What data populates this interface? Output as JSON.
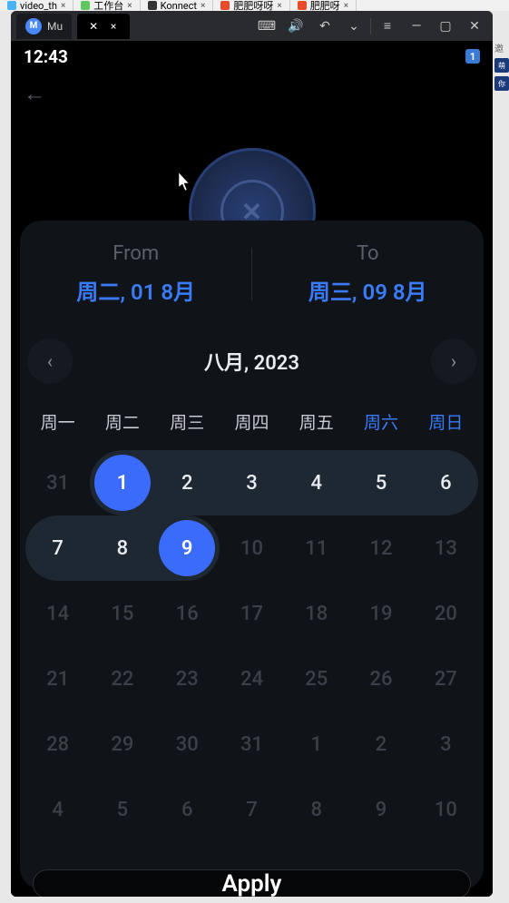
{
  "browser_tabs": [
    {
      "label": "video_th",
      "icon_color": "#4ab3f5"
    },
    {
      "label": "工作台",
      "icon_color": "#5ec85e"
    },
    {
      "label": "Konnect",
      "icon_color": "#333"
    },
    {
      "label": "肥肥呀呀",
      "icon_color": "#e84a2a"
    },
    {
      "label": "肥肥呀",
      "icon_color": "#e84a2a"
    }
  ],
  "emulator": {
    "app_initial": "M",
    "app_short": "Mu",
    "tab_icon": "✕",
    "toolbar_icons": [
      "⌨",
      "🔊",
      "↶",
      "⌄",
      "",
      "≡",
      "—",
      "▢",
      "✕"
    ]
  },
  "status": {
    "time": "12:43",
    "notif_count": "1"
  },
  "logo_text": "✕",
  "picker": {
    "from_label": "From",
    "from_value": "周二, 01 8月",
    "to_label": "To",
    "to_value": "周三, 09 8月",
    "month_title": "八月, 2023",
    "dow": [
      "周一",
      "周二",
      "周三",
      "周四",
      "周五",
      "周六",
      "周日"
    ],
    "days": [
      {
        "n": "31",
        "out": true
      },
      {
        "n": "1",
        "sel": "start"
      },
      {
        "n": "2",
        "between": true
      },
      {
        "n": "3",
        "between": true
      },
      {
        "n": "4",
        "between": true
      },
      {
        "n": "5",
        "between": true
      },
      {
        "n": "6",
        "between": true,
        "rowend": true
      },
      {
        "n": "7",
        "between": true,
        "rowstart": true
      },
      {
        "n": "8",
        "between": true
      },
      {
        "n": "9",
        "sel": "end"
      },
      {
        "n": "10",
        "out": true
      },
      {
        "n": "11",
        "out": true
      },
      {
        "n": "12",
        "out": true
      },
      {
        "n": "13",
        "out": true
      },
      {
        "n": "14",
        "out": true
      },
      {
        "n": "15",
        "out": true
      },
      {
        "n": "16",
        "out": true
      },
      {
        "n": "17",
        "out": true
      },
      {
        "n": "18",
        "out": true
      },
      {
        "n": "19",
        "out": true
      },
      {
        "n": "20",
        "out": true
      },
      {
        "n": "21",
        "out": true
      },
      {
        "n": "22",
        "out": true
      },
      {
        "n": "23",
        "out": true
      },
      {
        "n": "24",
        "out": true
      },
      {
        "n": "25",
        "out": true
      },
      {
        "n": "26",
        "out": true
      },
      {
        "n": "27",
        "out": true
      },
      {
        "n": "28",
        "out": true
      },
      {
        "n": "29",
        "out": true
      },
      {
        "n": "30",
        "out": true
      },
      {
        "n": "31",
        "out": true
      },
      {
        "n": "1",
        "out": true
      },
      {
        "n": "2",
        "out": true
      },
      {
        "n": "3",
        "out": true
      },
      {
        "n": "4",
        "out": true
      },
      {
        "n": "5",
        "out": true
      },
      {
        "n": "6",
        "out": true
      },
      {
        "n": "7",
        "out": true
      },
      {
        "n": "8",
        "out": true
      },
      {
        "n": "9",
        "out": true
      },
      {
        "n": "10",
        "out": true
      }
    ],
    "apply_label": "Apply"
  },
  "right_strip": {
    "b1": "邀",
    "b2": "萌",
    "b3": "你"
  }
}
